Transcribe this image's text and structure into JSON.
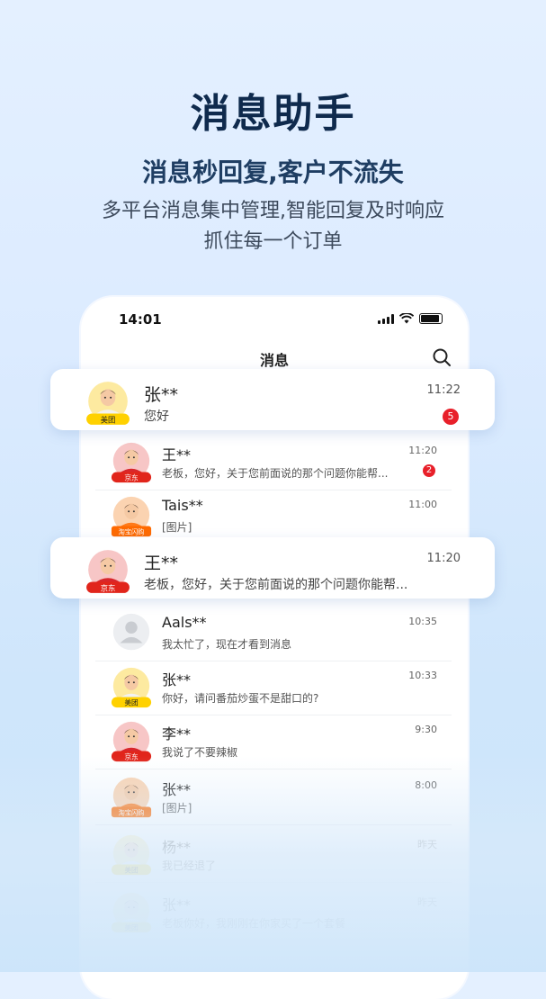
{
  "header": {
    "title": "消息助手",
    "subtitle": "消息秒回复,客户不流失",
    "desc_line1": "多平台消息集中管理,智能回复及时响应",
    "desc_line2": "抓住每一个订单"
  },
  "phone": {
    "status_time": "14:01",
    "nav_title": "消息"
  },
  "highlight_cards": [
    {
      "name": "张**",
      "message": "您好",
      "time": "11:22",
      "badge": "5",
      "platform": "美团"
    },
    {
      "name": "王**",
      "message": "老板，您好，关于您前面说的那个问题你能帮...",
      "time": "11:20",
      "platform": "京东"
    }
  ],
  "conversations": [
    {
      "name": "王**",
      "message": "老板，您好，关于您前面说的那个问题你能帮...",
      "time": "11:20",
      "badge": "2",
      "platform": "京东"
    },
    {
      "name": "Tais**",
      "message": "[图片]",
      "time": "11:00",
      "platform": "淘宝闪购"
    },
    {
      "name": "Aals**",
      "message": "我太忙了，现在才看到消息",
      "time": "10:35",
      "platform": ""
    },
    {
      "name": "张**",
      "message": "你好，请问番茄炒蛋不是甜口的?",
      "time": "10:33",
      "platform": "美团"
    },
    {
      "name": "李**",
      "message": "我说了不要辣椒",
      "time": "9:30",
      "platform": "京东"
    },
    {
      "name": "张**",
      "message": "[图片]",
      "time": "8:00",
      "platform": "淘宝闪购"
    },
    {
      "name": "杨**",
      "message": "我已经退了",
      "time": "昨天",
      "platform": "美团"
    },
    {
      "name": "张**",
      "message": "老板你好，我刚刚在你家买了一个套餐",
      "time": "昨天",
      "platform": "美团"
    }
  ],
  "colors": {
    "meituan": "#ffd100",
    "jingdong": "#e1251b",
    "taobao": "#ff6a00",
    "badge": "#e8202a",
    "title": "#0f2a4d"
  }
}
